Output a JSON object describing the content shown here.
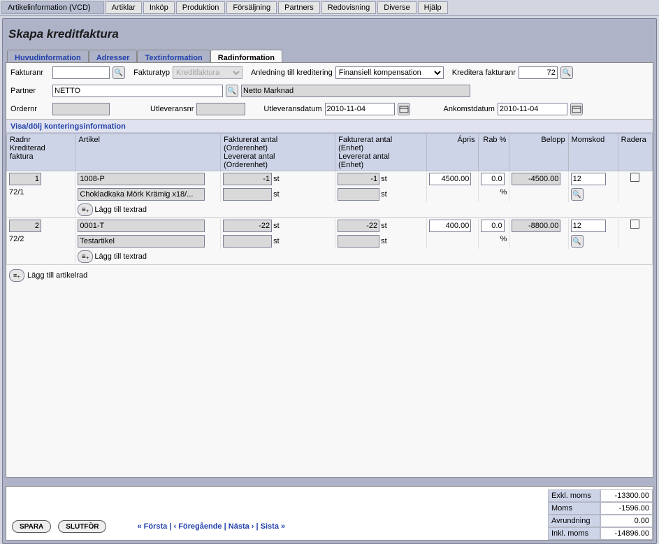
{
  "menu": {
    "items": [
      "Artikelinformation (VCD)",
      "Artiklar",
      "Inköp",
      "Produktion",
      "Försäljning",
      "Partners",
      "Redovisning",
      "Diverse",
      "Hjälp"
    ]
  },
  "page_title": "Skapa kreditfaktura",
  "tabs": {
    "items": [
      "Huvudinformation",
      "Adresser",
      "Textinformation",
      "Radinformation"
    ],
    "active_index": 3
  },
  "header": {
    "fakturanr_label": "Fakturanr",
    "fakturanr_value": "",
    "fakturatyp_label": "Fakturatyp",
    "fakturatyp_value": "Kreditfaktura",
    "anledning_label": "Anledning till kreditering",
    "anledning_value": "Finansiell kompensation",
    "kreditera_label": "Kreditera fakturanr",
    "kreditera_value": "72",
    "partner_label": "Partner",
    "partner_code": "NETTO",
    "partner_name": "Netto Marknad",
    "ordernr_label": "Ordernr",
    "ordernr_value": "",
    "utleveransnr_label": "Utleveransnr",
    "utleveransnr_value": "",
    "utleveransdatum_label": "Utleveransdatum",
    "utleveransdatum_value": "2010-11-04",
    "ankomstdatum_label": "Ankomstdatum",
    "ankomstdatum_value": "2010-11-04"
  },
  "toggle_konter_label": "Visa/dölj konteringsinformation",
  "grid": {
    "cols": {
      "radnr": "Radnr\nKrediterad\nfaktura",
      "artikel": "Artikel",
      "fao": "Fakturerat antal\n(Orderenhet)\nLevererat antal\n(Orderenhet)",
      "fae": "Fakturerat antal\n(Enhet)\nLevererat antal\n(Enhet)",
      "apris": "Ápris",
      "rab": "Rab %",
      "belopp": "Belopp",
      "momskod": "Momskod",
      "radera": "Radera"
    },
    "unit_label": "st",
    "percent_label": "%",
    "add_textrow_label": "Lägg till textrad",
    "add_articlerow_label": "Lägg till artikelrad",
    "rows": [
      {
        "radnr": "1",
        "kred_ref": "72/1",
        "article_code": "1008-P",
        "article_name": "Chokladkaka Mörk Krämig x18/...",
        "fao1": "-1",
        "fao_unit1": "st",
        "fao2": "",
        "fao_unit2": "st",
        "fae1": "-1",
        "fae_unit1": "st",
        "fae2": "",
        "fae_unit2": "st",
        "apris": "4500.00",
        "rab": "0.0",
        "rab2": "%",
        "belopp": "-4500.00",
        "momskod": "12"
      },
      {
        "radnr": "2",
        "kred_ref": "72/2",
        "article_code": "0001-T",
        "article_name": "Testartikel",
        "fao1": "-22",
        "fao_unit1": "st",
        "fao2": "",
        "fao_unit2": "st",
        "fae1": "-22",
        "fae_unit1": "st",
        "fae2": "",
        "fae_unit2": "st",
        "apris": "400.00",
        "rab": "0.0",
        "rab2": "%",
        "belopp": "-8800.00",
        "momskod": "12"
      }
    ]
  },
  "footer": {
    "save_label": "SPARA",
    "finish_label": "SLUTFÖR",
    "pager_first": "« Första",
    "pager_prev": "‹ Föregående",
    "pager_next": "Nästa ›",
    "pager_last": "Sista »",
    "totals": {
      "excl_label": "Exkl. moms",
      "excl_value": "-13300.00",
      "moms_label": "Moms",
      "moms_value": "-1596.00",
      "avrund_label": "Avrundning",
      "avrund_value": "0.00",
      "incl_label": "Inkl. moms",
      "incl_value": "-14896.00"
    }
  }
}
